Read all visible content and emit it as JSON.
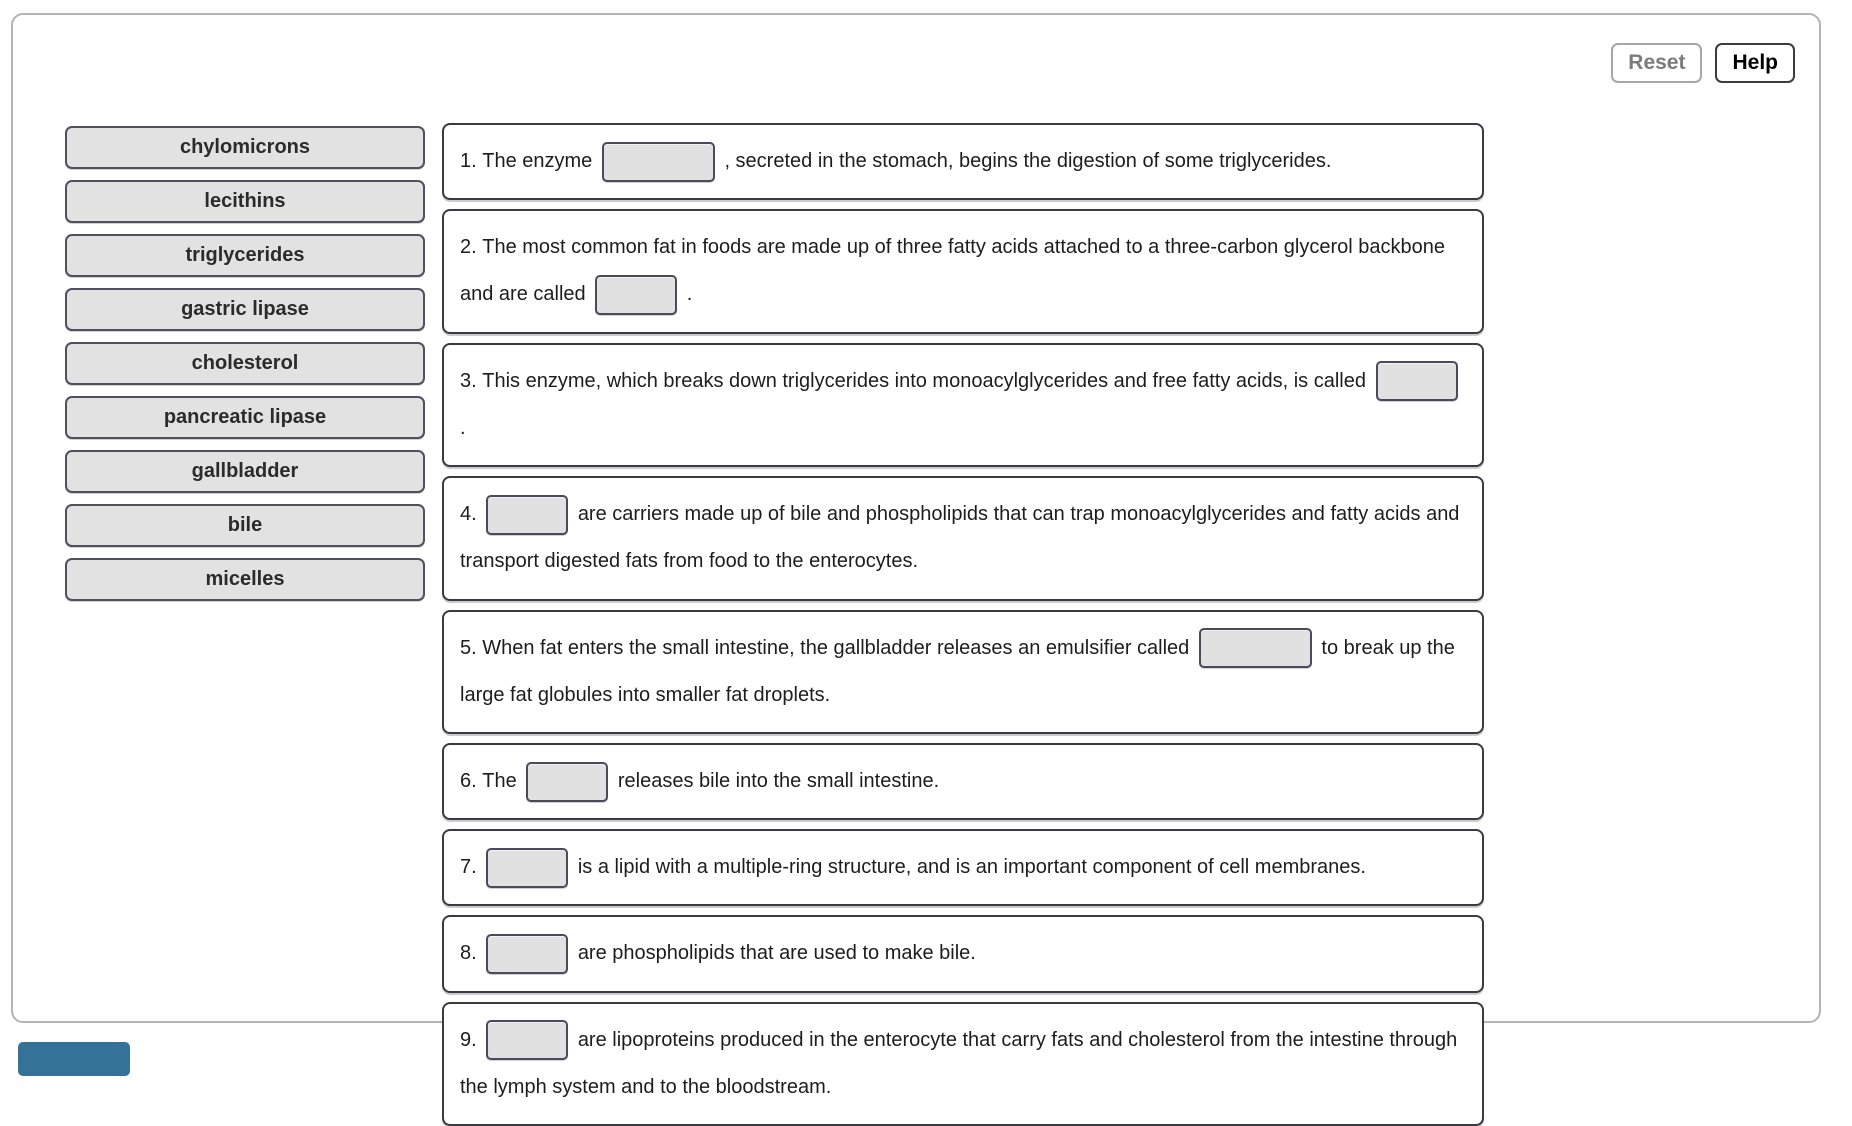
{
  "toolbar": {
    "reset_label": "Reset",
    "help_label": "Help"
  },
  "wordbank": {
    "items": [
      {
        "label": "chylomicrons"
      },
      {
        "label": "lecithins"
      },
      {
        "label": "triglycerides"
      },
      {
        "label": "gastric lipase"
      },
      {
        "label": "cholesterol"
      },
      {
        "label": "pancreatic lipase"
      },
      {
        "label": "gallbladder"
      },
      {
        "label": "bile"
      },
      {
        "label": "micelles"
      }
    ]
  },
  "questions": [
    {
      "number": "1.",
      "before": "The enzyme",
      "after": ", secreted in the stomach, begins the digestion of some triglycerides.",
      "answer": ""
    },
    {
      "number": "2.",
      "before": "The most common fat in foods are made up of three fatty acids attached to a three-carbon glycerol backbone and are called",
      "after": ".",
      "answer": ""
    },
    {
      "number": "3.",
      "before": "This enzyme, which breaks down triglycerides into monoacylglycerides and free fatty acids, is called",
      "after": ".",
      "answer": ""
    },
    {
      "number": "4.",
      "before": "",
      "after": "are carriers made up of bile and phospholipids that can trap monoacylglycerides and fatty acids and transport digested fats from food to the enterocytes.",
      "answer": ""
    },
    {
      "number": "5.",
      "before": "When fat enters the small intestine, the gallbladder releases an emulsifier called",
      "after": "to break up the large fat globules into smaller fat droplets.",
      "answer": ""
    },
    {
      "number": "6.",
      "before": "The",
      "after": "releases bile into the small intestine.",
      "answer": ""
    },
    {
      "number": "7.",
      "before": "",
      "after": "is a lipid with a multiple-ring structure, and is an important component of cell membranes.",
      "answer": ""
    },
    {
      "number": "8.",
      "before": "",
      "after": "are phospholipids that are used to make bile.",
      "answer": ""
    },
    {
      "number": "9.",
      "before": "",
      "after": "are lipoproteins produced in the enterocyte that carry fats and cholesterol from the intestine through the lymph system and to the bloodstream.",
      "answer": ""
    }
  ],
  "submit": {
    "label": ""
  },
  "colors": {
    "accent": "#357298",
    "word_item_bg": "#e2e2e2",
    "dropzone_bg": "#e1e1e1",
    "box_border": "#3a3a44",
    "frame_border": "#b4b4b4"
  }
}
